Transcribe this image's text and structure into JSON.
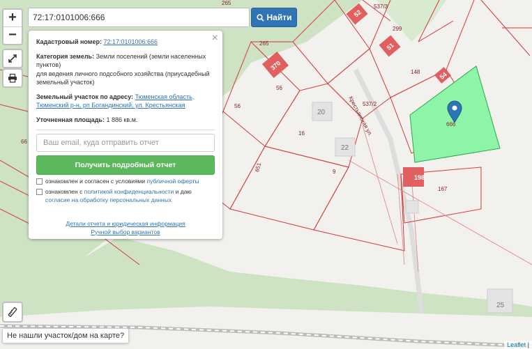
{
  "search": {
    "query": "72:17:0101006:666",
    "button_label": "Найти"
  },
  "controls": {
    "zoom_in": "+",
    "zoom_out": "−"
  },
  "popup": {
    "close_glyph": "×",
    "cadastral_label": "Кадастровый номер:",
    "cadastral_value": "72:17:0101006:666",
    "category_label": "Категория земель:",
    "category_value": "Земли поселений (земли населенных пунктов)",
    "category_purpose": "для ведения личного подсобного хозяйства (приусадебный земельный участок)",
    "address_label": "Земельный участок по адресу:",
    "address_value": "Тюменская область, Тюменский р-н, рп Богандинский, ул. Крестьянская",
    "area_label": "Уточненная площадь:",
    "area_value": "1 886 кв.м.",
    "email_placeholder": "Ваш email, куда отправить отчет",
    "report_button": "Получить подробный отчет",
    "consent1_text": "ознакомлен и согласен с условиями",
    "consent1_link": "публичной оферты",
    "consent2_text": "ознакомлен с",
    "consent2_link1": "политикой конфиденциальности",
    "consent2_and": "и даю",
    "consent2_link2": "согласие на обработку персональных данных",
    "details_link": "Детали отчета и юридическая информация",
    "manual_link": "Ручной выбор вариантов"
  },
  "map": {
    "street_name": "Крестьянская ул.",
    "selected_plot_label": "666",
    "plot_labels": [
      "537/3",
      "299",
      "265",
      "265",
      "56",
      "56",
      "148",
      "537/2",
      "16",
      "9",
      "651",
      "167",
      "66"
    ],
    "house_labels": [
      "52",
      "51",
      "370",
      "54",
      "198"
    ],
    "building_labels": [
      "20",
      "22",
      "25"
    ],
    "colors": {
      "forest": "#cde3c4",
      "selected_fill": "#8ef5a8",
      "boundary": "#d23a3a",
      "house": "#e06060",
      "marker": "#2f74b5"
    }
  },
  "footer": {
    "not_found": "Не нашли участок/дом на карте?",
    "attribution_link": "Leaflet",
    "attribution_sep": "|"
  }
}
